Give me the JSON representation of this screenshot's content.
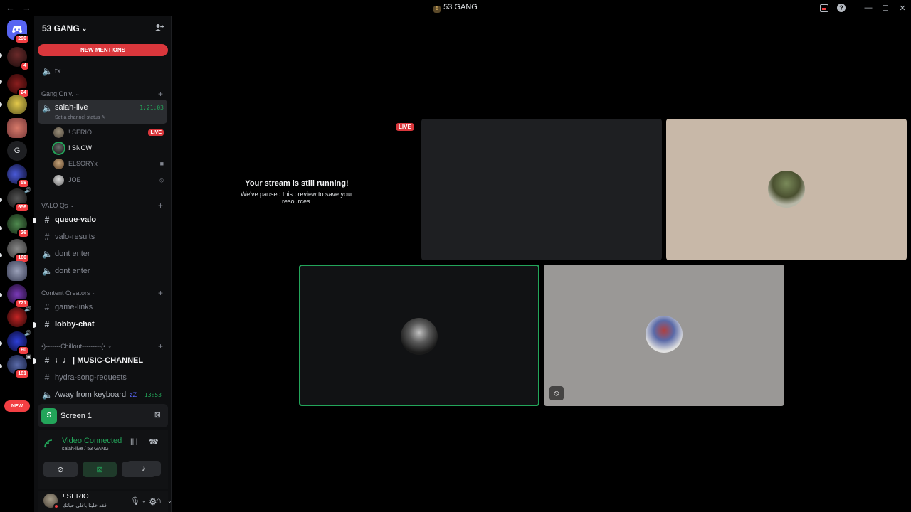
{
  "window": {
    "title": "53 GANG",
    "nav_back": "←",
    "nav_forward": "→",
    "inbox_icon": "inbox-icon",
    "help": "?",
    "minimize": "—",
    "maximize": "☐",
    "close": "✕"
  },
  "rail": {
    "servers": [
      {
        "name": "dm-home",
        "badge": "290"
      },
      {
        "name": "server-2",
        "badge": "4"
      },
      {
        "name": "server-3",
        "badge": "24"
      },
      {
        "name": "server-4",
        "badge": ""
      },
      {
        "name": "server-5",
        "badge": ""
      },
      {
        "name": "server-g",
        "label": "G",
        "badge": ""
      },
      {
        "name": "server-7",
        "badge": "58"
      },
      {
        "name": "server-8",
        "badge": "656"
      },
      {
        "name": "server-9",
        "badge": "26"
      },
      {
        "name": "server-10",
        "badge": "160"
      },
      {
        "name": "server-11",
        "badge": ""
      },
      {
        "name": "server-12",
        "badge": "721"
      },
      {
        "name": "server-13",
        "badge": ""
      },
      {
        "name": "server-14",
        "badge": "60"
      },
      {
        "name": "server-15",
        "badge": "181"
      }
    ],
    "new_label": "NEW"
  },
  "sidebar": {
    "guild_name": "53 GANG",
    "new_mentions": "NEW MENTIONS",
    "tx_channel": "tx",
    "categories": {
      "gang_only": "Gang Only.",
      "valo_qs": "VALO Qs",
      "content_creators": "Content Creators",
      "chillout": "•)-------Chillout---------(•"
    },
    "active_channel": {
      "name": "salah-live",
      "timer": "1:21:03",
      "status": "Set a channel status"
    },
    "voice_users": [
      {
        "name": "! SERIO",
        "tag": "LIVE"
      },
      {
        "name": "! SNOW",
        "tag": ""
      },
      {
        "name": "ELSORYx",
        "tag": ""
      },
      {
        "name": "JOE",
        "tag": ""
      }
    ],
    "channels": {
      "queue_valo": "queue-valo",
      "valo_results": "valo-results",
      "dont_enter_1": "dont enter",
      "dont_enter_2": "dont enter",
      "game_links": "game-links",
      "lobby_chat": "lobby-chat",
      "music_channel": "♩♩ | MUSIC-CHANNEL",
      "hydra": "hydra-song-requests",
      "afk": "Away from keyboard",
      "afk_time": "13:53"
    }
  },
  "screen_panel": {
    "label": "Screen 1"
  },
  "voice_panel": {
    "status": "Video Connected",
    "location": "salah-live / 53 GANG"
  },
  "user_panel": {
    "username": "! SERIO",
    "status": "ﻓﻘﺪ ﺧﻠﻴﻨﺎ ﺑﺄﻏﻠﻰ ﺣﺒﺎﺗﻚ"
  },
  "stage": {
    "live_tag": "LIVE",
    "paused_title": "Your stream is still running!",
    "paused_body": "We've paused this preview to save your resources."
  },
  "colors": {
    "accent_green": "#23a55a",
    "danger_red": "#da373c",
    "background": "#000000",
    "sidebar": "#0e0f11"
  }
}
